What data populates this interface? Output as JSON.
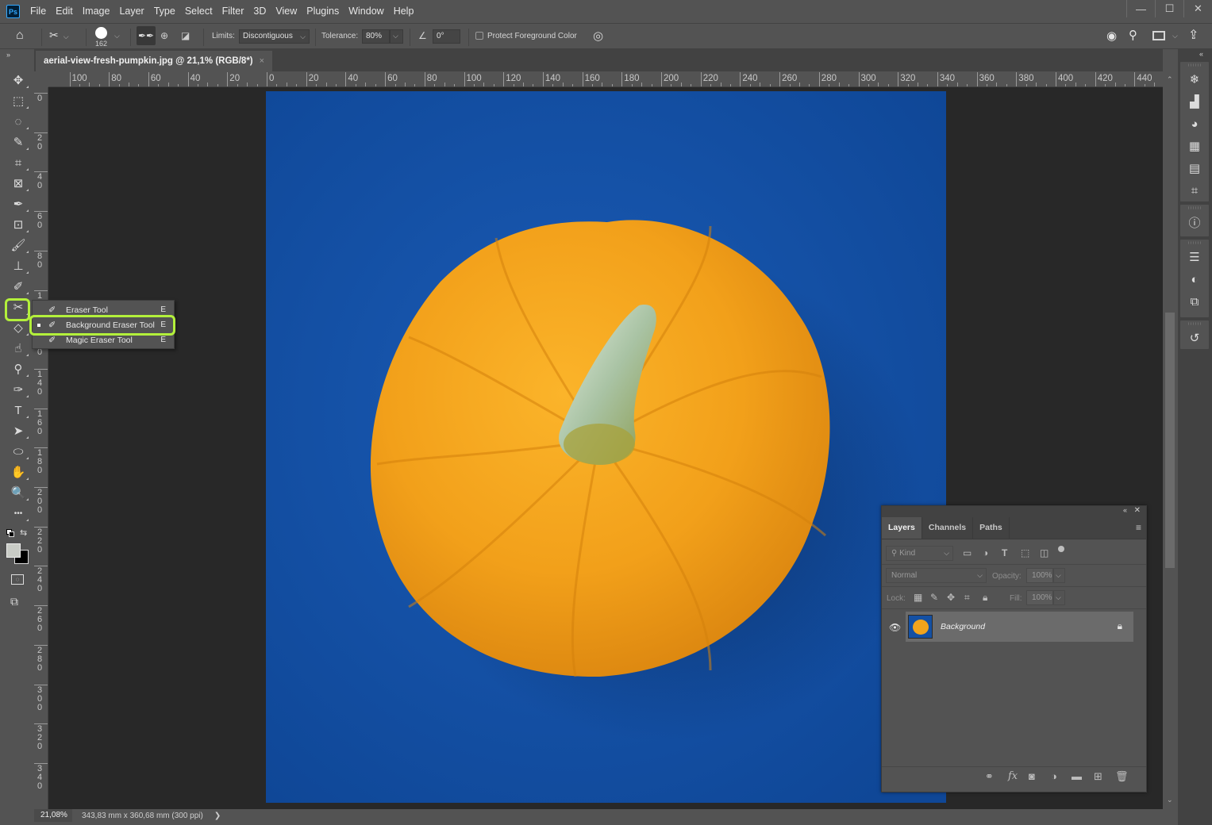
{
  "app": {
    "logo": "Ps",
    "name": "Adobe Photoshop"
  },
  "menu": [
    "File",
    "Edit",
    "Image",
    "Layer",
    "Type",
    "Select",
    "Filter",
    "3D",
    "View",
    "Plugins",
    "Window",
    "Help"
  ],
  "window_controls": {
    "minimize": "—",
    "maximize": "☐",
    "close": "✕"
  },
  "options_bar": {
    "brush_size": "162",
    "limits_label": "Limits:",
    "limits_value": "Discontiguous",
    "tolerance_label": "Tolerance:",
    "tolerance_value": "80%",
    "angle_value": "0°",
    "protect_foreground_label": "Protect Foreground Color",
    "protect_foreground_checked": false
  },
  "document": {
    "tab_title": "aerial-view-fresh-pumpkin.jpg @ 21,1% (RGB/8*)",
    "close": "×"
  },
  "rulers": {
    "horizontal": [
      "100",
      "80",
      "60",
      "40",
      "20",
      "0",
      "20",
      "40",
      "60",
      "80",
      "100",
      "120",
      "140",
      "160",
      "180",
      "200",
      "220",
      "240",
      "260",
      "280",
      "300",
      "320",
      "340",
      "360",
      "380",
      "400",
      "420",
      "440"
    ],
    "vertical": [
      "0",
      "20",
      "40",
      "60",
      "80",
      "100",
      "120",
      "140",
      "160",
      "180",
      "200",
      "220",
      "240",
      "260",
      "280",
      "300",
      "320",
      "340"
    ]
  },
  "tools": [
    {
      "name": "move-tool-icon",
      "glyph": "✥"
    },
    {
      "name": "marquee-tool-icon",
      "glyph": "⬚"
    },
    {
      "name": "lasso-tool-icon",
      "glyph": "◌"
    },
    {
      "name": "quick-selection-tool-icon",
      "glyph": "✎"
    },
    {
      "name": "crop-tool-icon",
      "glyph": "⌗"
    },
    {
      "name": "frame-tool-icon",
      "glyph": "⊠"
    },
    {
      "name": "eyedropper-tool-icon",
      "glyph": "✒"
    },
    {
      "name": "spot-healing-tool-icon",
      "glyph": "⊡"
    },
    {
      "name": "brush-tool-icon",
      "glyph": "🖌"
    },
    {
      "name": "clone-stamp-tool-icon",
      "glyph": "⊥"
    },
    {
      "name": "history-brush-tool-icon",
      "glyph": "✐"
    },
    {
      "name": "background-eraser-tool-icon",
      "glyph": "✂"
    },
    {
      "name": "paint-bucket-tool-icon",
      "glyph": "◇"
    },
    {
      "name": "smudge-tool-icon",
      "glyph": "☝"
    },
    {
      "name": "dodge-tool-icon",
      "glyph": "⚲"
    },
    {
      "name": "pen-tool-icon",
      "glyph": "✑"
    },
    {
      "name": "type-tool-icon",
      "glyph": "T"
    },
    {
      "name": "path-selection-tool-icon",
      "glyph": "➤"
    },
    {
      "name": "ellipse-tool-icon",
      "glyph": "⬭"
    },
    {
      "name": "hand-tool-icon",
      "glyph": "✋"
    },
    {
      "name": "zoom-tool-icon",
      "glyph": "🔍"
    },
    {
      "name": "edit-toolbar-icon",
      "glyph": "•••"
    }
  ],
  "colors": {
    "foreground": "#c9ccc6",
    "background": "#000000",
    "highlight": "#b3f03b",
    "canvas_blue": "#1450a3",
    "pumpkin": "#f2a41c"
  },
  "flyout": {
    "items": [
      {
        "label": "Eraser Tool",
        "key": "E",
        "selected": false
      },
      {
        "label": "Background Eraser Tool",
        "key": "E",
        "selected": true
      },
      {
        "label": "Magic Eraser Tool",
        "key": "E",
        "selected": false
      }
    ]
  },
  "status": {
    "zoom": "21,08%",
    "doc_info": "343,83 mm x 360,68 mm (300 ppi)",
    "arrow": "❯"
  },
  "right_panel_icons": [
    "navigator-icon",
    "histogram-icon",
    "color-icon",
    "swatches-icon",
    "gradients-icon",
    "patterns-icon",
    "info-icon",
    "adjustments-icon",
    "styles-icon",
    "libraries-icon",
    "history-icon"
  ],
  "layers_panel": {
    "tabs": [
      "Layers",
      "Channels",
      "Paths"
    ],
    "active_tab": "Layers",
    "filter_placeholder": "Kind",
    "blend_mode": "Normal",
    "opacity_label": "Opacity:",
    "opacity_value": "100%",
    "lock_label": "Lock:",
    "fill_label": "Fill:",
    "fill_value": "100%",
    "layers": [
      {
        "name": "Background",
        "visible": true,
        "locked": true
      }
    ]
  }
}
